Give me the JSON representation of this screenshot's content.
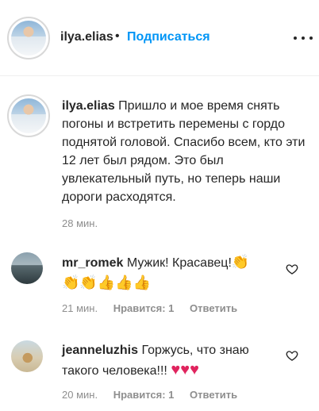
{
  "header": {
    "username": "ilya.elias",
    "separator": "•",
    "follow_label": "Подписаться",
    "more_icon": "more-horizontal-icon"
  },
  "post": {
    "username": "ilya.elias",
    "caption": "Пришло и мое время снять погоны и встретить перемены с гордо поднятой головой. Спасибо всем, кто эти 12 лет был рядом. Это был увлекательный путь, но теперь наши дороги расходятся.",
    "time": "28 мин."
  },
  "comments": [
    {
      "username": "mr_romek",
      "text": "Мужик! Красавец!",
      "emoji_line1": "👏",
      "emoji_line2": "👏👏👍👍👍",
      "time": "21 мин.",
      "likes": "Нравится: 1",
      "reply": "Ответить"
    },
    {
      "username": "jeanneluzhis",
      "text": "Горжусь, что знаю такого человека!!!",
      "emoji": "♥♥♥",
      "time": "20 мин.",
      "likes": "Нравится: 1",
      "reply": "Ответить"
    }
  ],
  "colors": {
    "link_blue": "#0095f6",
    "text": "#262626",
    "muted": "#8e8e8e",
    "divider": "#efefef",
    "heart_red": "#e0245e"
  }
}
